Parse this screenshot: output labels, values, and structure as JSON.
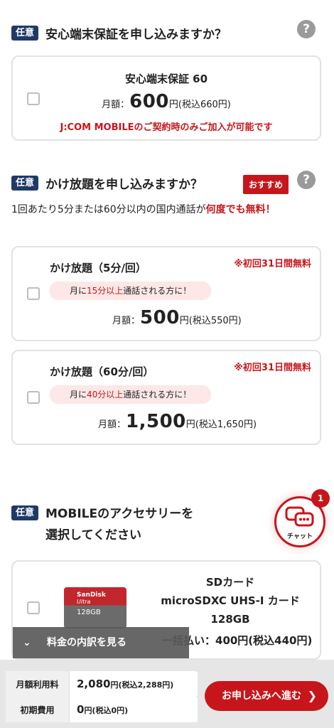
{
  "guarantee": {
    "badge": "任意",
    "title": "安心端末保証を申し込みますか？",
    "help": "?",
    "card": {
      "name": "安心端末保証 60",
      "price_prefix": "月額：",
      "price": "600",
      "price_suffix": "円(税込660円)",
      "note": "J:COM MOBILEのご契約時のみご加入が可能です"
    }
  },
  "kakehodai": {
    "badge": "任意",
    "title": "かけ放題を申し込みますか？",
    "recommend": "おすすめ",
    "help": "?",
    "desc_pre": "1回あたり5分または60分以内の国内通話が",
    "desc_red": "何度でも無料！",
    "plans": [
      {
        "name": "かけ放題（5分/回）",
        "free": "※初回31日間無料",
        "pill_pre": "月に",
        "pill_hl": "15分以上",
        "pill_post": "通話される方に！",
        "price_prefix": "月額：",
        "price": "500",
        "price_suffix": "円(税込550円)"
      },
      {
        "name": "かけ放題（60分/回）",
        "free": "※初回31日間無料",
        "pill_pre": "月に",
        "pill_hl": "40分以上",
        "pill_post": "通話される方に！",
        "price_prefix": "月額：",
        "price": "1,500",
        "price_suffix": "円(税込1,650円)"
      }
    ]
  },
  "accessory": {
    "badge": "任意",
    "title_line1": "MOBILEのアクセサリーを",
    "title_line2": "選択してください",
    "item": {
      "line1": "SDカード",
      "line2": "microSDXC UHS-I カード",
      "line3": "128GB",
      "price": "一括払い：400円(税込440円)",
      "card_brand": "SanDisk",
      "card_series": "Ultra",
      "card_capacity": "128GB"
    }
  },
  "chat": {
    "label": "チャット",
    "count": "1"
  },
  "breakdown": {
    "label": "料金の内訳を見る"
  },
  "footer": {
    "monthly_label": "月額利用料",
    "monthly_value": "2,080",
    "monthly_suffix": "円(税込2,288円)",
    "initial_label": "初期費用",
    "initial_value": "0",
    "initial_suffix": "円(税込0円)",
    "apply_label": "お申し込みへ進む"
  }
}
